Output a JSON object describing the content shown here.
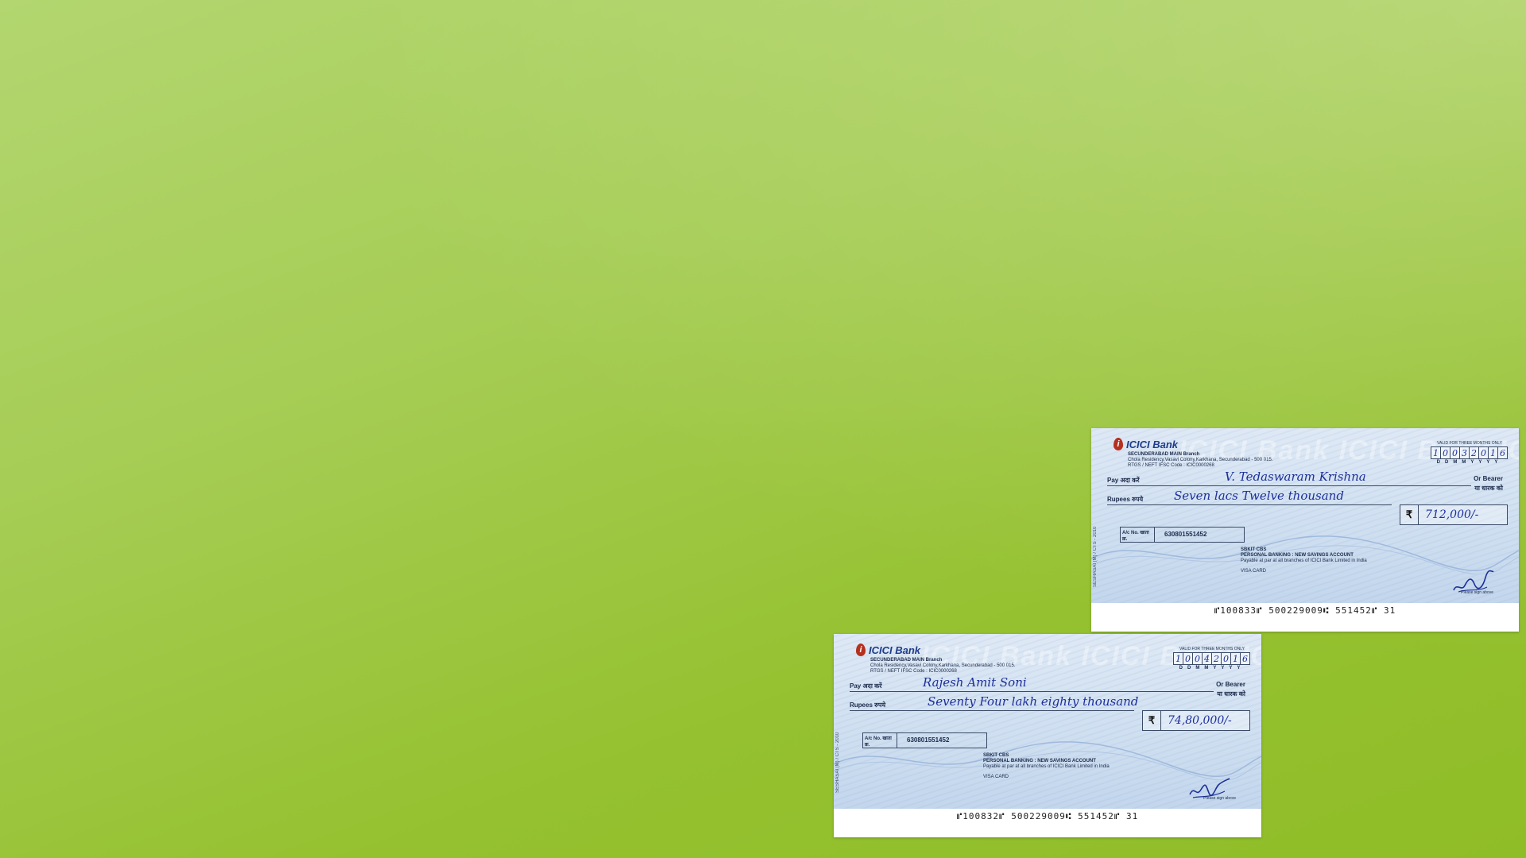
{
  "cheques": [
    {
      "bank": {
        "name": "ICICI Bank",
        "logo_letter": "i",
        "branch_name": "SECUNDERABAD MAIN Branch",
        "address": "Chola Residency,Vasavi Colony,Karkhana, Secunderabad - 500 015.",
        "ifsc": "RTGS / NEFT IFSC Code : ICIC0000268"
      },
      "watermark": "ICICI Bank ICICI Bank ICICI Bank",
      "side_text": "SESHASAI (M) / CTS - 2010",
      "validity": "VALID FOR THREE MONTHS ONLY",
      "date_digits": [
        "1",
        "0",
        "0",
        "3",
        "2",
        "0",
        "1",
        "6"
      ],
      "date_legend": "DDMMYYYY",
      "pay_label": "Pay अदा करें",
      "payee": "V. Tedaswaram Krishna",
      "or_bearer": "Or Bearer",
      "or_bearer_hindi": "या धारक को",
      "rupees_label": "Rupees रुपये",
      "amount_words": "Seven lacs Twelve thousand",
      "currency_symbol": "₹",
      "amount_figures": "712,000/-",
      "acno_label": "A/c No. खाता क्र.",
      "acno_value": "630801551452",
      "acct_code": "SBKIT        CBS",
      "acct_type": "PERSONAL BANKING : NEW SAVINGS ACCOUNT",
      "acct_note": "Payable at par at all branches of ICICI Bank Limited in India",
      "card": "VISA CARD",
      "sign_above": "Please sign above",
      "micr": "⑈100833⑈ 500229009⑆ 551452⑈ 31"
    },
    {
      "bank": {
        "name": "ICICI Bank",
        "logo_letter": "i",
        "branch_name": "SECUNDERABAD MAIN Branch",
        "address": "Chola Residency,Vasavi Colony,Karkhana, Secunderabad - 500 015.",
        "ifsc": "RTGS / NEFT IFSC Code : ICIC0000268"
      },
      "watermark": "ICICI Bank ICICI Bank ICICI Bank",
      "side_text": "SESHASAI (M) / CTS - 2010",
      "validity": "VALID FOR THREE MONTHS ONLY",
      "date_digits": [
        "1",
        "0",
        "0",
        "4",
        "2",
        "0",
        "1",
        "6"
      ],
      "date_legend": "DDMMYYYY",
      "pay_label": "Pay अदा करें",
      "payee": "Rajesh Amit Soni",
      "or_bearer": "Or Bearer",
      "or_bearer_hindi": "या धारक को",
      "rupees_label": "Rupees रुपये",
      "amount_words": "Seventy Four lakh eighty thousand",
      "currency_symbol": "₹",
      "amount_figures": "74,80,000/-",
      "acno_label": "A/c No. खाता क्र.",
      "acno_value": "630801551452",
      "acct_code": "SBKIT        CBS",
      "acct_type": "PERSONAL BANKING : NEW SAVINGS ACCOUNT",
      "acct_note": "Payable at par at all branches of ICICI Bank Limited in India",
      "card": "VISA CARD",
      "sign_above": "Please sign above",
      "micr": "⑈100832⑈ 500229009⑆ 551452⑈ 31"
    }
  ]
}
